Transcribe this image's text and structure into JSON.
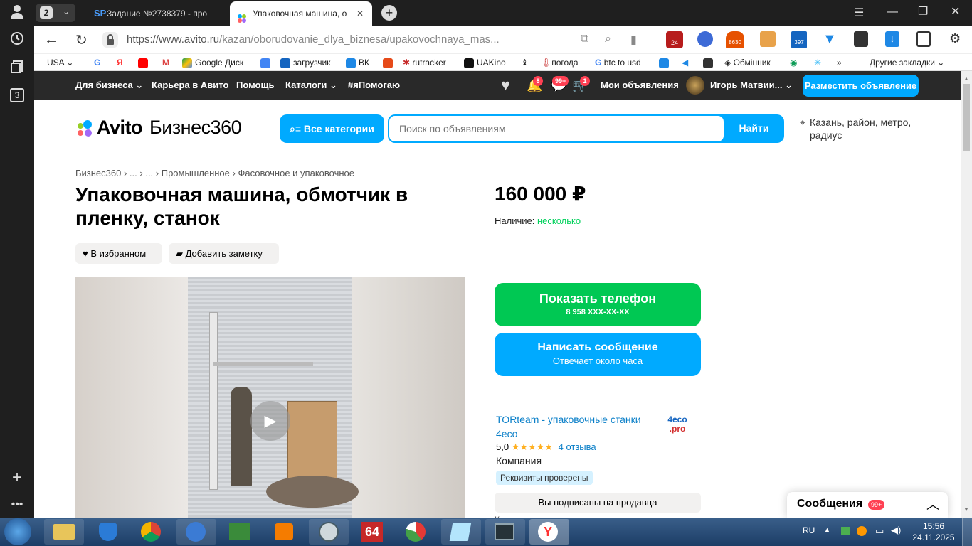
{
  "browser": {
    "tab_count": "2",
    "tabs": [
      {
        "label": "Задание №2738379 - про"
      },
      {
        "label": "Упаковочная машина, о"
      }
    ],
    "url_prefix": "https://www.avito.ru",
    "url_path": "/kazan/oborudovanie_dlya_biznesa/upakovochnaya_mas...",
    "sidebar_badge": "3",
    "ext_badges": {
      "ext24": "24",
      "ext8630": "8630",
      "ext397": "397"
    },
    "bookmarks": [
      "USA",
      "Google Диск",
      "загрузчик",
      "ВК",
      "rutracker",
      "UAKino",
      "погода",
      "btc to usd",
      "Обмінник"
    ],
    "other_bookmarks": "Другие закладки",
    "more_bookmarks": "»"
  },
  "topnav": {
    "business": "Для бизнеса",
    "career": "Карьера в Авито",
    "help": "Помощь",
    "catalogs": "Каталоги",
    "ihelp": "#яПомогаю",
    "notif_badge": "8",
    "msg_badge": "99+",
    "cart_badge": "1",
    "my_ads": "Мои объявления",
    "user": "Игорь Матвии...",
    "post_ad": "Разместить объявление"
  },
  "header": {
    "logo_avito": "Avito",
    "logo_b360": "Бизнес360",
    "all_categories": "Все категории",
    "search_placeholder": "Поиск по объявлениям",
    "search_btn": "Найти",
    "location": "Казань, район, метро, радиус"
  },
  "listing": {
    "breadcrumbs": [
      "Бизнес360",
      "...",
      "...",
      "Промышленное",
      "Фасовочное и упаковочное"
    ],
    "title": "Упаковочная машина, обмотчик в пленку, станок",
    "favorite": "В избранном",
    "add_note": "Добавить заметку",
    "price": "160 000 ₽",
    "availability_label": "Наличие:",
    "availability_value": "несколько",
    "show_phone": "Показать телефон",
    "phone": "8 958 XXX-XX-XX",
    "write_msg": "Написать сообщение",
    "reply_time": "Отвечает около часа"
  },
  "seller": {
    "name": "TORteam - упаковочные станки 4eco",
    "rating": "5,0",
    "stars": "★★★★★",
    "reviews": "4 отзыва",
    "type": "Компания",
    "verified": "Реквизиты проверены",
    "logo_text1": "4eco",
    "logo_text2": ".pro",
    "subscribed": "Вы подписаны на продавца",
    "extra": "Контактное лицо"
  },
  "messages_widget": {
    "label": "Сообщения",
    "badge": "99+"
  },
  "taskbar": {
    "lang": "RU",
    "time": "15:56",
    "date": "24.11.2025",
    "app64": "64"
  },
  "colors": {
    "avito_blue": "#00aaff",
    "avito_green": "#00c853",
    "topnav_bg": "#292929"
  }
}
